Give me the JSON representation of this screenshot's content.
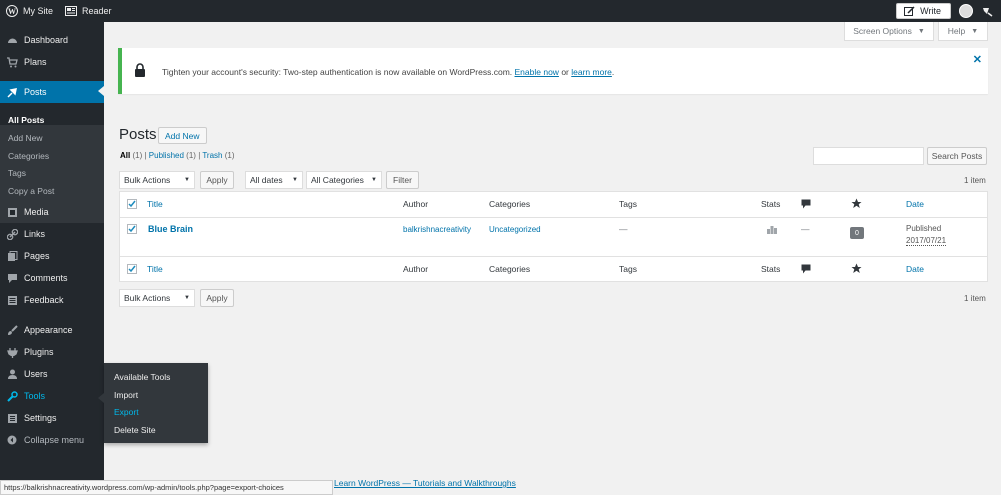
{
  "topbar": {
    "site": "My Site",
    "reader": "Reader",
    "write": "Write"
  },
  "sidebar": {
    "items": [
      {
        "label": "Dashboard",
        "icon": "dashboard-icon"
      },
      {
        "label": "Plans",
        "icon": "cart-icon"
      },
      {
        "label": "Posts",
        "icon": "pin-icon"
      },
      {
        "label": "Media",
        "icon": "media-icon"
      },
      {
        "label": "Links",
        "icon": "links-icon"
      },
      {
        "label": "Pages",
        "icon": "pages-icon"
      },
      {
        "label": "Comments",
        "icon": "comments-icon"
      },
      {
        "label": "Feedback",
        "icon": "feedback-icon"
      },
      {
        "label": "Appearance",
        "icon": "brush-icon"
      },
      {
        "label": "Plugins",
        "icon": "plug-icon"
      },
      {
        "label": "Users",
        "icon": "users-icon"
      },
      {
        "label": "Tools",
        "icon": "wrench-icon"
      },
      {
        "label": "Settings",
        "icon": "settings-icon"
      },
      {
        "label": "Collapse menu",
        "icon": "collapse-icon"
      }
    ],
    "submenu": [
      "All Posts",
      "Add New",
      "Categories",
      "Tags",
      "Copy a Post"
    ]
  },
  "flyout": [
    "Available Tools",
    "Import",
    "Export",
    "Delete Site"
  ],
  "screen_options": "Screen Options",
  "help": "Help",
  "notice": {
    "text": "Tighten your account's security: Two-step authentication is now available on WordPress.com.",
    "enable": "Enable now",
    "or": "or",
    "learn": "learn more",
    "period": "."
  },
  "posts": {
    "title": "Posts",
    "add_new": "Add New",
    "filters": {
      "all": "All",
      "all_count": "(1)",
      "published": "Published",
      "published_count": "(1)",
      "trash": "Trash",
      "trash_count": "(1)",
      "sep": "|"
    },
    "search_button": "Search Posts",
    "bulk_actions": "Bulk Actions",
    "apply": "Apply",
    "all_dates": "All dates",
    "all_categories": "All Categories",
    "filter": "Filter",
    "count": "1 item"
  },
  "table": {
    "headers": {
      "title": "Title",
      "author": "Author",
      "categories": "Categories",
      "tags": "Tags",
      "stats": "Stats",
      "date": "Date"
    },
    "rows": [
      {
        "title": "Blue Brain",
        "author": "balkrishnacreativity",
        "categories": "Uncategorized",
        "tags": "—",
        "comments_dash": "—",
        "likes": "0",
        "status": "Published",
        "date": "2017/07/21"
      }
    ]
  },
  "status_bar": "https://balkrishnacreativity.wordpress.com/wp-admin/tools.php?page=export-choices",
  "footer_link": "Learn WordPress — Tutorials and Walkthroughs"
}
